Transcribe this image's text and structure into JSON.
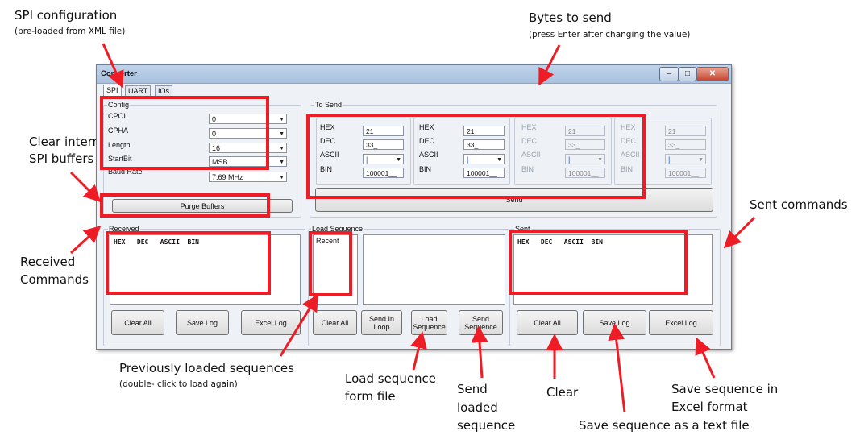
{
  "annotations": {
    "spi_config": "SPI configuration",
    "spi_config_sub": "(pre-loaded from XML file)",
    "bytes_to_send": "Bytes to send",
    "bytes_to_send_sub": "(press Enter after changing the value)",
    "clear_internal": "Clear internal",
    "spi_buffers": "SPI buffers",
    "sent_commands": "Sent commands",
    "received": "Received",
    "commands": "Commands",
    "prev_loaded": "Previously loaded sequences",
    "prev_loaded_sub": "(double- click to load again)",
    "load_seq_line1": "Load sequence",
    "load_seq_line2": "form file",
    "send_loaded_1": "Send",
    "send_loaded_2": "loaded",
    "send_loaded_3": "sequence",
    "clear": "Clear",
    "save_excel_1": "Save sequence in",
    "save_excel_2": "Excel format",
    "save_text": "Save sequence as a text file"
  },
  "window": {
    "title": "Converter",
    "tabs": [
      "SPI",
      "UART",
      "IOs"
    ],
    "config": {
      "group_label": "Config",
      "rows": [
        {
          "label": "CPOL",
          "value": "0"
        },
        {
          "label": "CPHA",
          "value": "0"
        },
        {
          "label": "Length",
          "value": "16"
        },
        {
          "label": "StartBit",
          "value": "MSB"
        },
        {
          "label": "Baud Rate",
          "value": "7.69 MHz"
        }
      ],
      "purge_button": "Purge Buffers"
    },
    "to_send": {
      "group_label": "To Send",
      "blocks": [
        {
          "hex_label": "HEX",
          "hex": "21",
          "dec_label": "DEC",
          "dec": "33_",
          "ascii_label": "ASCII",
          "ascii": "|",
          "bin_label": "BIN",
          "bin": "100001__"
        },
        {
          "hex_label": "HEX",
          "hex": "21",
          "dec_label": "DEC",
          "dec": "33_",
          "ascii_label": "ASCII",
          "ascii": "|",
          "bin_label": "BIN",
          "bin": "100001__"
        },
        {
          "hex_label": "HEX",
          "hex": "21",
          "dec_label": "DEC",
          "dec": "33_",
          "ascii_label": "ASCII",
          "ascii": "|",
          "bin_label": "BIN",
          "bin": "100001__"
        },
        {
          "hex_label": "HEX",
          "hex": "21",
          "dec_label": "DEC",
          "dec": "33_",
          "ascii_label": "ASCII",
          "ascii": "|",
          "bin_label": "BIN",
          "bin": "100001__"
        }
      ],
      "send_button": "Send"
    },
    "received": {
      "group_label": "Received",
      "header": "HEX   DEC   ASCII  BIN",
      "buttons": [
        "Clear All",
        "Save Log",
        "Excel Log"
      ]
    },
    "load_sequence": {
      "group_label": "Load Sequence",
      "recent_label": "Recent",
      "buttons": [
        "Clear All",
        "Send In Loop",
        "Load Sequence",
        "Send Sequence"
      ]
    },
    "sent": {
      "group_label": "Sent",
      "header": "HEX   DEC   ASCII  BIN",
      "buttons": [
        "Clear All",
        "Save Log",
        "Excel Log"
      ]
    }
  },
  "colors": {
    "highlight": "#ee1c24",
    "window_bg": "#eef1f6",
    "titlebar": "#b5cbe5"
  }
}
